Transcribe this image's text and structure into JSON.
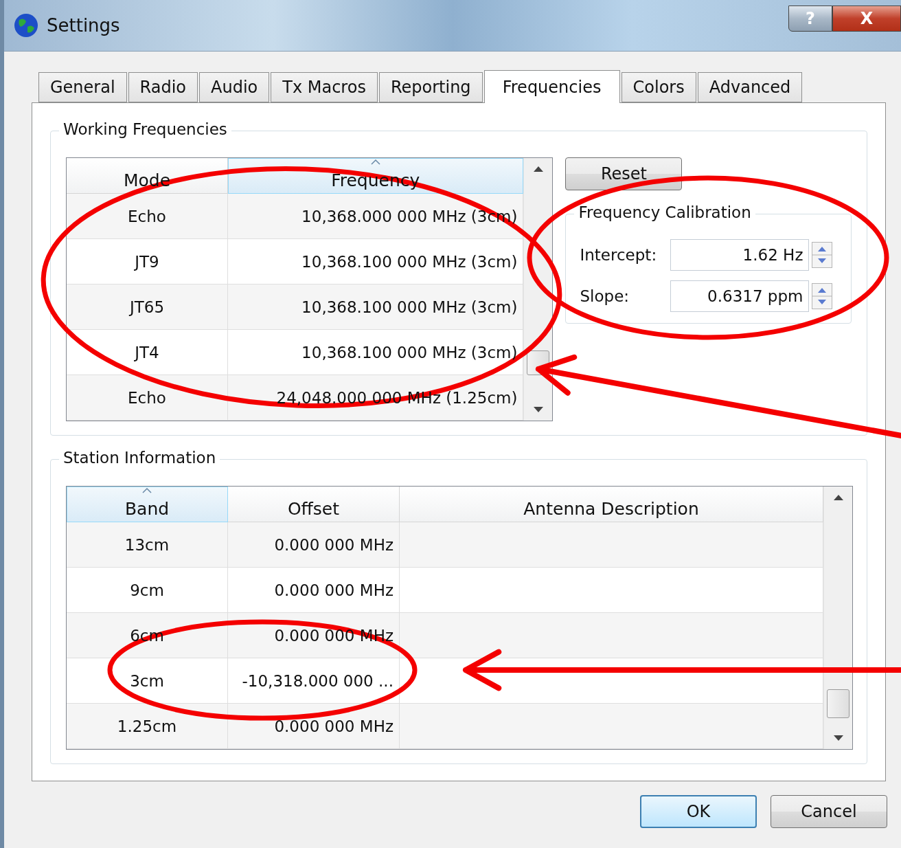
{
  "window": {
    "title": "Settings",
    "buttons": [
      {
        "kind": "help",
        "label": "?"
      },
      {
        "kind": "close",
        "label": "X"
      }
    ]
  },
  "tabs": [
    {
      "label": "General",
      "selected": false
    },
    {
      "label": "Radio",
      "selected": false
    },
    {
      "label": "Audio",
      "selected": false
    },
    {
      "label": "Tx Macros",
      "selected": false
    },
    {
      "label": "Reporting",
      "selected": false
    },
    {
      "label": "Frequencies",
      "selected": true
    },
    {
      "label": "Colors",
      "selected": false
    },
    {
      "label": "Advanced",
      "selected": false
    }
  ],
  "working_frequencies": {
    "title": "Working Frequencies",
    "columns": [
      {
        "label": "Mode",
        "sorted": false
      },
      {
        "label": "Frequency",
        "sorted": true
      }
    ],
    "rows": [
      {
        "mode": "Echo",
        "frequency": "10,368.000 000 MHz (3cm)"
      },
      {
        "mode": "JT9",
        "frequency": "10,368.100 000 MHz (3cm)"
      },
      {
        "mode": "JT65",
        "frequency": "10,368.100 000 MHz (3cm)"
      },
      {
        "mode": "JT4",
        "frequency": "10,368.100 000 MHz (3cm)"
      },
      {
        "mode": "Echo",
        "frequency": "24,048.000 000 MHz (1.25cm)"
      }
    ],
    "reset_button": "Reset",
    "calibration": {
      "title": "Frequency Calibration",
      "fields": [
        {
          "label": "Intercept:",
          "value": "1.62 Hz"
        },
        {
          "label": "Slope:",
          "value": "0.6317 ppm"
        }
      ]
    }
  },
  "station_information": {
    "title": "Station Information",
    "columns": [
      {
        "label": "Band",
        "sorted": true
      },
      {
        "label": "Offset",
        "sorted": false
      },
      {
        "label": "Antenna Description",
        "sorted": false
      }
    ],
    "rows": [
      {
        "band": "13cm",
        "offset": "0.000 000 MHz"
      },
      {
        "band": "9cm",
        "offset": "0.000 000 MHz"
      },
      {
        "band": "6cm",
        "offset": "0.000 000 MHz"
      },
      {
        "band": "3cm",
        "offset": "-10,318.000 000 ..."
      },
      {
        "band": "1.25cm",
        "offset": "0.000 000 MHz"
      }
    ]
  },
  "buttons": [
    {
      "label": "OK",
      "focused": true
    },
    {
      "label": "Cancel",
      "focused": false
    }
  ],
  "annotations": [
    {
      "kind": "ellipse"
    },
    {
      "kind": "ellipse"
    },
    {
      "kind": "ellipse"
    },
    {
      "kind": "arrow"
    },
    {
      "kind": "arrow"
    }
  ]
}
